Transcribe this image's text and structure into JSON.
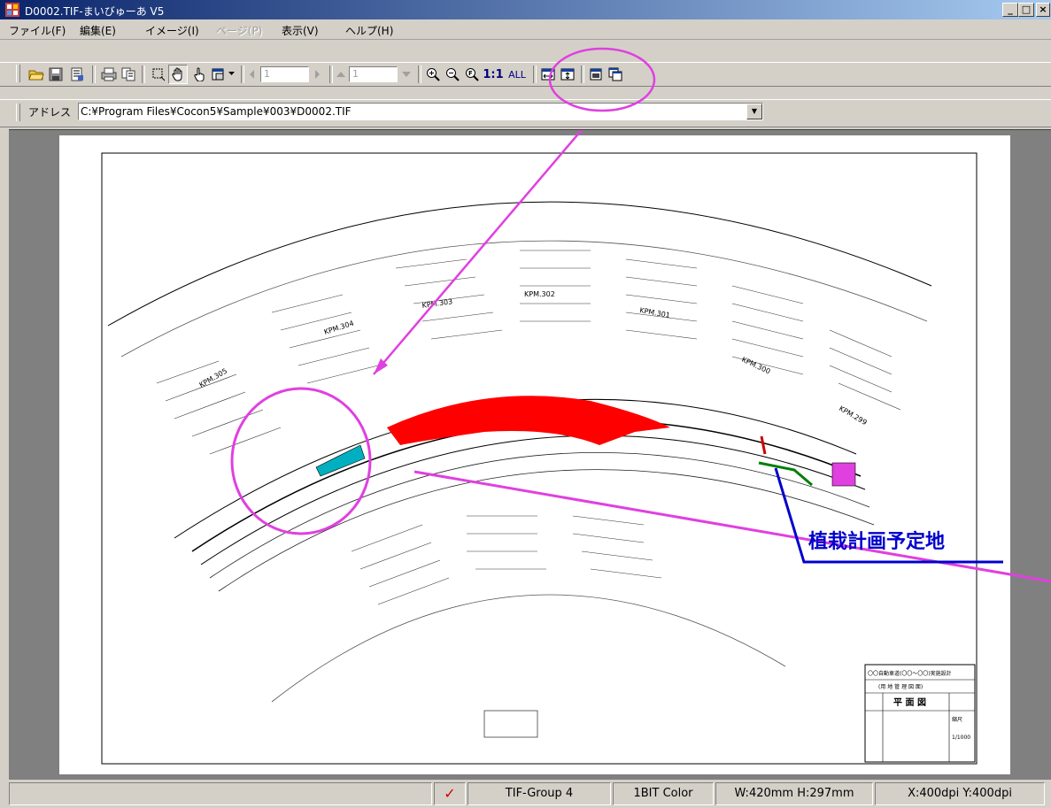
{
  "window": {
    "title": "D0002.TIF-まいびゅーあ V5",
    "minimize": "_",
    "maximize": "□",
    "close": "×"
  },
  "menu": [
    {
      "label": "ファイル(F)",
      "disabled": false
    },
    {
      "label": "編集(E)",
      "disabled": false
    },
    {
      "label": "イメージ(I)",
      "disabled": false
    },
    {
      "label": "ページ(P)",
      "disabled": true
    },
    {
      "label": "表示(V)",
      "disabled": false
    },
    {
      "label": "ヘルプ(H)",
      "disabled": false
    }
  ],
  "toolbar": {
    "page_value": "1",
    "page_value2": "1",
    "zoom_1to1": "1:1",
    "zoom_all": "ALL"
  },
  "address": {
    "label": "アドレス",
    "value": "C:¥Program Files¥Cocon5¥Sample¥003¥D0002.TIF"
  },
  "drawing": {
    "annotation": "植栽計画予定地",
    "stations": [
      "KPM.305",
      "KPM.304",
      "KPM.303",
      "KPM.302",
      "KPM.301",
      "KPM.300",
      "KPM.299"
    ],
    "title_block": {
      "line1": "〇〇自動車道(〇〇〜〇〇)実施設計",
      "line2": "(用 地 管 理 図 面)",
      "main": "平 面 図",
      "scale_label": "縮尺",
      "scale": "1/1000"
    }
  },
  "status": {
    "check": "✓",
    "format": "TIF-Group 4",
    "color": "1BIT Color",
    "size": "W:420mm H:297mm",
    "dpi": "X:400dpi Y:400dpi"
  },
  "colors": {
    "highlight_magenta": "#e040e0",
    "annotation_blue": "#0000cc",
    "fill_red": "#ff0000",
    "fill_cyan": "#00b0c0"
  }
}
